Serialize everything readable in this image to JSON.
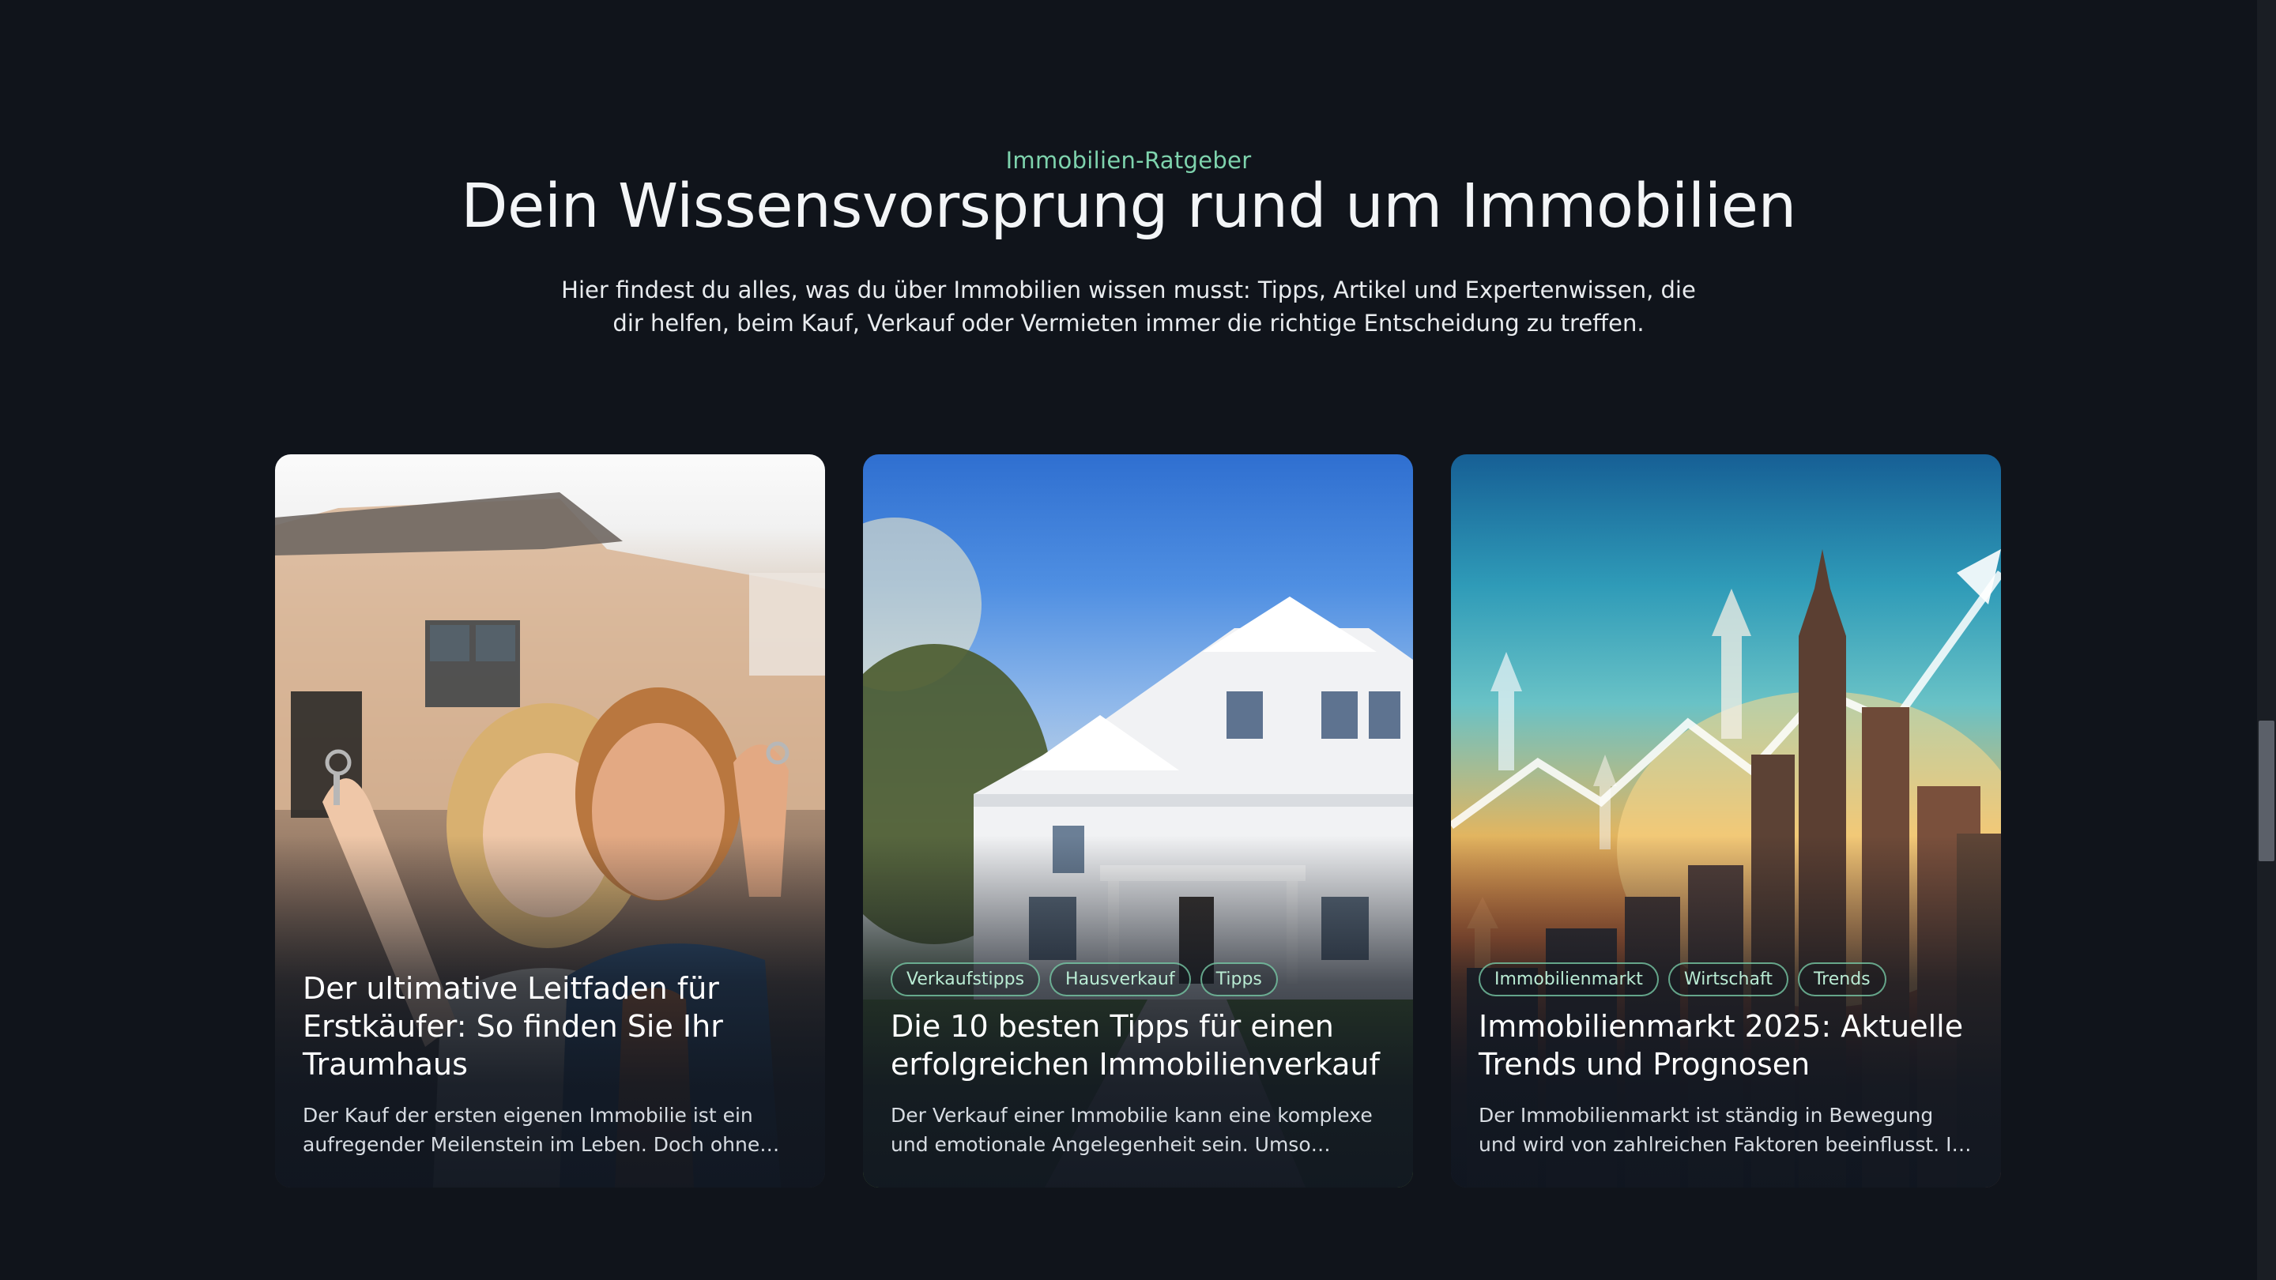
{
  "section": {
    "eyebrow": "Immobilien-Ratgeber",
    "title": "Dein Wissensvorsprung rund um Immobilien",
    "intro": "Hier findest du alles, was du über Immobilien wissen musst: Tipps, Artikel und Expertenwissen, die dir helfen, beim Kauf, Verkauf oder Vermieten immer die richtige Entscheidung zu treffen."
  },
  "colors": {
    "background": "#10141b",
    "accent": "#7ed3ad"
  },
  "articles": [
    {
      "tags": [],
      "title": "Der ultimative Leitfaden für Erstkäufer: So finden Sie Ihr Traumhaus",
      "excerpt": "Der Kauf der ersten eigenen Immobilie ist ein aufregender Meilenstein im Leben. Doch ohne…",
      "image": "couple-holding-keys-in-front-of-house"
    },
    {
      "tags": [
        "Verkaufstipps",
        "Hausverkauf",
        "Tipps"
      ],
      "title": "Die 10 besten Tipps für einen erfolgreichen Immobilienverkauf",
      "excerpt": "Der Verkauf einer Immobilie kann eine komplexe und emotionale Angelegenheit sein. Umso wichtig…",
      "image": "white-house-under-blue-sky"
    },
    {
      "tags": [
        "Immobilienmarkt",
        "Wirtschaft",
        "Trends"
      ],
      "title": "Immobilienmarkt 2025: Aktuelle Trends und Prognosen",
      "excerpt": "Der Immobilienmarkt ist ständig in Bewegung und wird von zahlreichen Faktoren beeinflusst. Im Jahr…",
      "image": "city-skyline-with-rising-arrows"
    }
  ]
}
